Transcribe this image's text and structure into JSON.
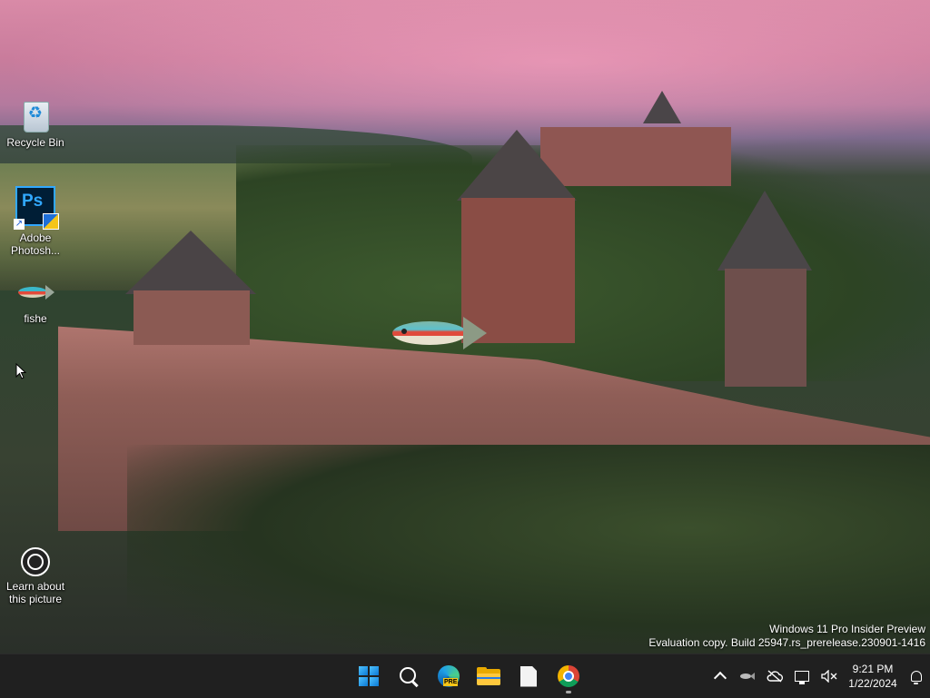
{
  "desktop": {
    "icons": [
      {
        "label": "Recycle Bin",
        "icon": "recycle-bin-icon"
      },
      {
        "label": "Adobe Photosh...",
        "icon": "photoshop-icon"
      },
      {
        "label": "fishe",
        "icon": "fish-icon"
      },
      {
        "label": "Learn about this picture",
        "icon": "learn-about-picture-icon"
      }
    ],
    "watermark": {
      "line1": "Windows 11 Pro Insider Preview",
      "line2": "Evaluation copy. Build 25947.rs_prerelease.230901-1416"
    }
  },
  "taskbar": {
    "apps": [
      {
        "name": "Start",
        "icon": "windows-start-icon"
      },
      {
        "name": "Search",
        "icon": "search-icon"
      },
      {
        "name": "Microsoft Edge Insider",
        "icon": "edge-pre-icon",
        "badge": "PRE"
      },
      {
        "name": "File Explorer",
        "icon": "folder-icon"
      },
      {
        "name": "Notepad",
        "icon": "document-icon"
      },
      {
        "name": "Google Chrome",
        "icon": "chrome-icon"
      }
    ],
    "tray": {
      "clock_time": "9:21 PM",
      "clock_date": "1/22/2024"
    }
  },
  "colors": {
    "taskbar_bg": "#202020",
    "accent": "#0a78d4"
  }
}
